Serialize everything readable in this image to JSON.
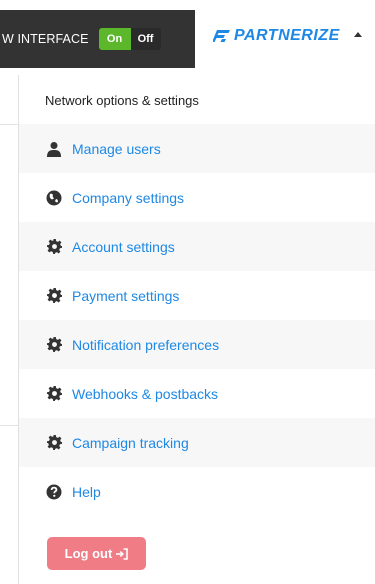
{
  "header": {
    "interface_label": "W INTERFACE",
    "toggle_on": "On",
    "toggle_off": "Off",
    "brand": "PARTNERIZE"
  },
  "menu": {
    "heading": "Network options & settings",
    "items": [
      {
        "label": "Manage users",
        "icon": "user-icon"
      },
      {
        "label": "Company settings",
        "icon": "globe-icon"
      },
      {
        "label": "Account settings",
        "icon": "gear-icon"
      },
      {
        "label": "Payment settings",
        "icon": "gear-icon"
      },
      {
        "label": "Notification preferences",
        "icon": "gear-icon"
      },
      {
        "label": "Webhooks & postbacks",
        "icon": "gear-icon"
      },
      {
        "label": "Campaign tracking",
        "icon": "gear-icon"
      },
      {
        "label": "Help",
        "icon": "question-circle-icon"
      }
    ],
    "logout": "Log out"
  },
  "colors": {
    "link": "#1e88e5",
    "toggle_on": "#5cb82a",
    "logout_button": "#f07c86",
    "topbar_dark": "#333333"
  }
}
